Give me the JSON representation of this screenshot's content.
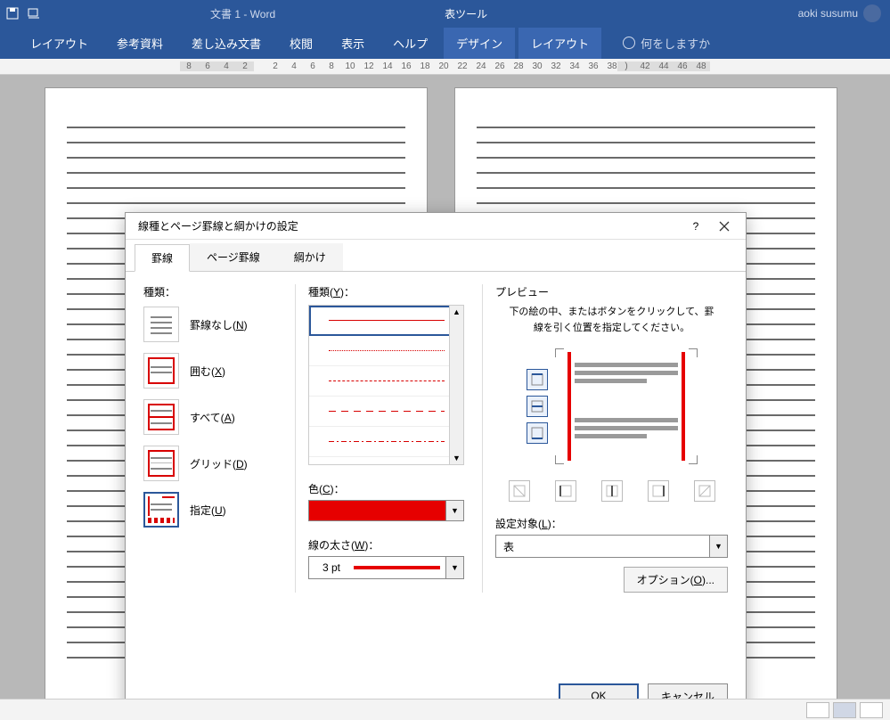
{
  "titlebar": {
    "doc": "文書 1  -  Word",
    "tool": "表ツール",
    "user": "aoki susumu"
  },
  "ribbon": {
    "tabs": [
      "レイアウト",
      "参考資料",
      "差し込み文書",
      "校閲",
      "表示",
      "ヘルプ"
    ],
    "ctx_tabs": [
      "デザイン",
      "レイアウト"
    ],
    "tellme": "何をしますか"
  },
  "ruler": {
    "left": [
      "8",
      "6",
      "4",
      "2"
    ],
    "mid": [
      "2",
      "4",
      "6",
      "8",
      "10",
      "12",
      "14",
      "16",
      "18",
      "20",
      "22",
      "24",
      "26",
      "28",
      "30",
      "32",
      "34",
      "36",
      "38"
    ],
    "right": [
      "42",
      "44",
      "46",
      "48"
    ]
  },
  "dialog": {
    "title": "線種とページ罫線と綱かけの設定",
    "help": "?",
    "tabs": {
      "t1": "罫線",
      "t2": "ページ罫線",
      "t3": "綱かけ"
    },
    "col_settings_label": "種類：",
    "settings": {
      "none": "罫線なし(N)",
      "box": "囲む(X)",
      "all": "すべて(A)",
      "grid": "グリッド(D)",
      "custom": "指定(U)"
    },
    "style_label": "種類(Y)：",
    "color_label": "色(C)：",
    "color_value": "#e60000",
    "width_label": "線の太さ(W)：",
    "width_value": "3 pt",
    "preview_label": "プレビュー",
    "preview_hint": "下の絵の中、またはボタンをクリックして、罫線を引く位置を指定してください。",
    "apply_label": "設定対象(L)：",
    "apply_value": "表",
    "options_btn": "オプション(O)...",
    "ok": "OK",
    "cancel": "キャンセル"
  }
}
